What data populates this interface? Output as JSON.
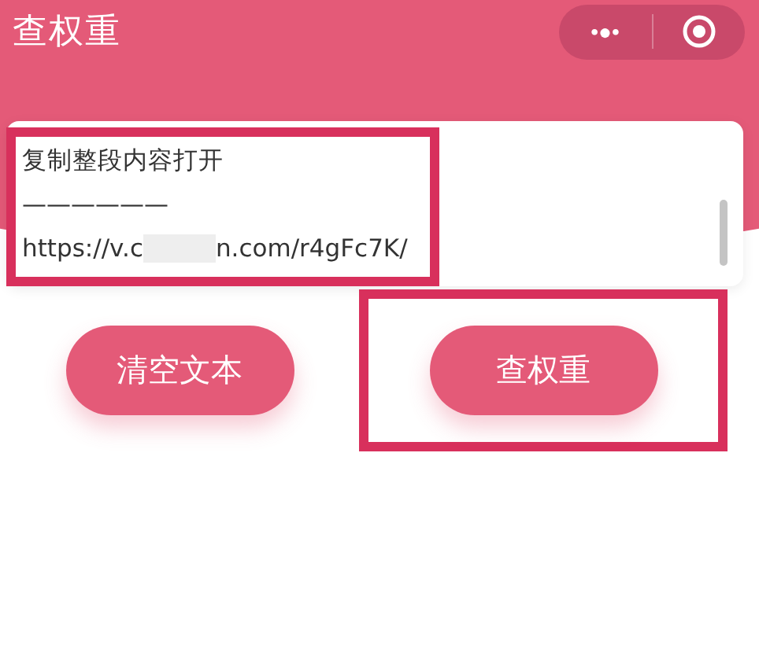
{
  "header": {
    "title": "查权重",
    "capsule": {
      "more": "•●•"
    }
  },
  "text_area": {
    "lines": [
      "复制整段内容打开",
      "——————"
    ],
    "url_start": "https://v.c",
    "url_end": "n.com/r4gFc7K/",
    "highlighted": true
  },
  "buttons": [
    {
      "label": "清空文本",
      "highlighted": false
    },
    {
      "label": "查权重",
      "highlighted": true
    }
  ]
}
